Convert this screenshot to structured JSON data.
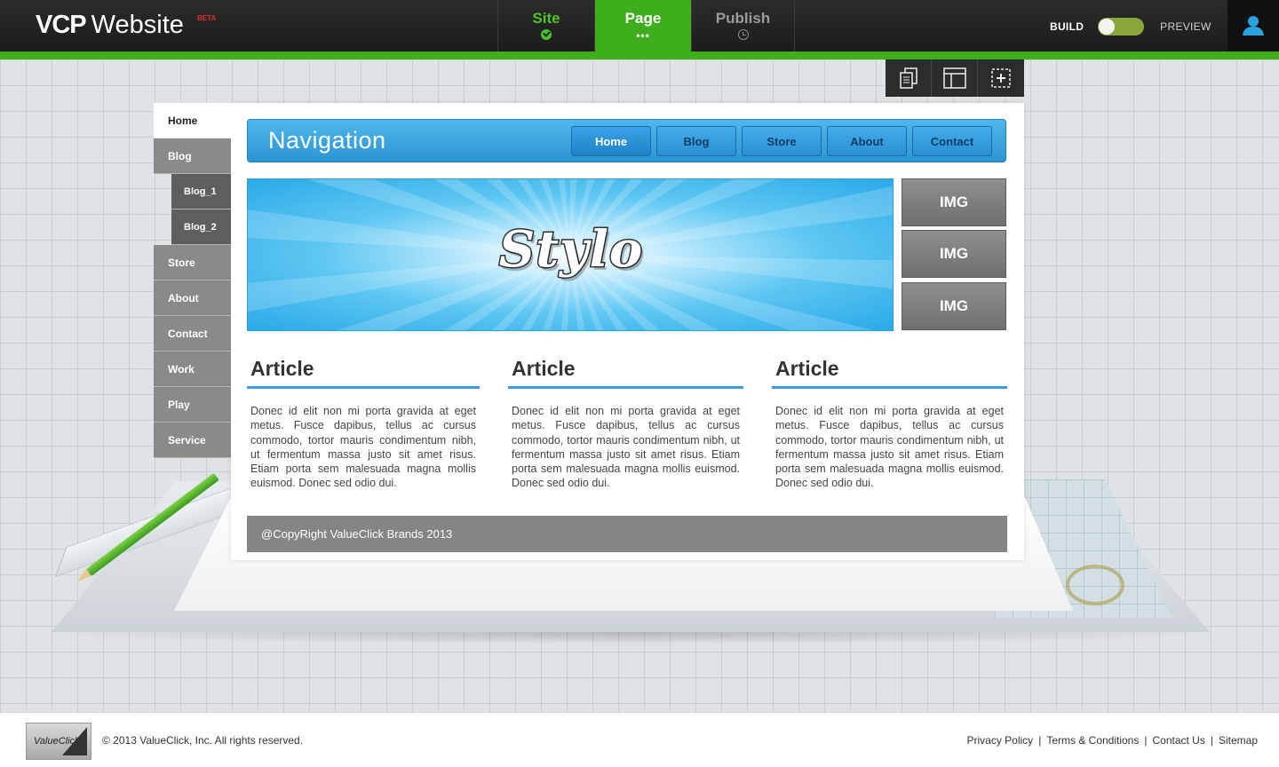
{
  "header": {
    "logo_main": "VCP",
    "logo_word": "Website",
    "logo_badge": "BETA",
    "steps": [
      {
        "label": "Site",
        "state": "done"
      },
      {
        "label": "Page",
        "state": "active",
        "sub": "•••"
      },
      {
        "label": "Publish",
        "state": "pending"
      }
    ],
    "build_label": "BUILD",
    "preview_label": "PREVIEW",
    "toggle_icon": "toggle-switch",
    "user_icon": "user-icon"
  },
  "tools": [
    "pages-icon",
    "layout-icon",
    "add-element-icon"
  ],
  "pages": [
    {
      "label": "Home",
      "active": true
    },
    {
      "label": "Blog"
    },
    {
      "label": "Blog_1",
      "child": true
    },
    {
      "label": "Blog_2",
      "child": true
    },
    {
      "label": "Store"
    },
    {
      "label": "About"
    },
    {
      "label": "Contact"
    },
    {
      "label": "Work"
    },
    {
      "label": "Play"
    },
    {
      "label": "Service"
    }
  ],
  "site": {
    "nav_title": "Navigation",
    "nav_items": [
      "Home",
      "Blog",
      "Store",
      "About",
      "Contact"
    ],
    "banner_text": "Stylo",
    "images": [
      "IMG",
      "IMG",
      "IMG"
    ],
    "articles": [
      {
        "title": "Article",
        "body": "Donec id elit non mi porta gravida at eget metus. Fusce dapibus, tellus ac cursus commodo, tortor mauris condimentum nibh, ut fermentum massa justo sit amet risus. Etiam porta sem malesuada magna mollis euismod. Donec sed odio dui."
      },
      {
        "title": "Article",
        "body": "Donec id elit non mi porta gravida at eget metus. Fusce dapibus, tellus ac cursus commodo, tortor mauris condimentum nibh, ut fermentum massa justo sit amet risus. Etiam porta sem malesuada magna mollis euismod. Donec sed odio dui."
      },
      {
        "title": "Article",
        "body": "Donec id elit non mi porta gravida at eget metus. Fusce dapibus, tellus ac cursus commodo, tortor mauris condimentum nibh, ut fermentum massa justo sit amet risus. Etiam porta sem malesuada magna mollis euismod. Donec sed odio dui."
      }
    ],
    "footer_text": "@CopyRight ValueClick Brands 2013"
  },
  "footer": {
    "logo_text": "ValueClick",
    "copyright": "© 2013 ValueClick, Inc. All rights reserved.",
    "links": [
      "Privacy Policy",
      "Terms & Conditions",
      "Contact Us",
      "Sitemap"
    ]
  },
  "colors": {
    "accent_green": "#3eae1d",
    "nav_blue": "#2b95d4",
    "topbar": "#1f1f1f"
  }
}
